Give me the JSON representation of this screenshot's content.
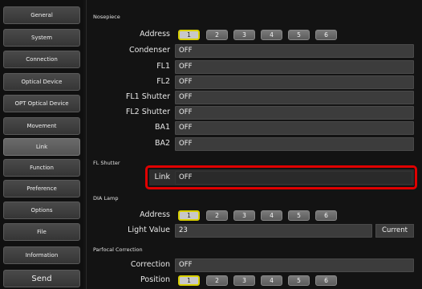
{
  "sidebar": {
    "items": [
      "General",
      "System",
      "Connection",
      "Optical Device",
      "OPT Optical Device",
      "Movement",
      "Link",
      "Function",
      "Preference",
      "Options",
      "File",
      "Information"
    ],
    "active": "Link",
    "send_label": "Send"
  },
  "nosepiece": {
    "title": "Nosepiece",
    "address_label": "Address",
    "addresses": [
      "1",
      "2",
      "3",
      "4",
      "5",
      "6"
    ],
    "selected": "1",
    "rows": [
      {
        "label": "Condenser",
        "value": "OFF"
      },
      {
        "label": "FL1",
        "value": "OFF"
      },
      {
        "label": "FL2",
        "value": "OFF"
      },
      {
        "label": "FL1 Shutter",
        "value": "OFF"
      },
      {
        "label": "FL2 Shutter",
        "value": "OFF"
      },
      {
        "label": "BA1",
        "value": "OFF"
      },
      {
        "label": "BA2",
        "value": "OFF"
      }
    ]
  },
  "fl_shutter": {
    "title": "FL Shutter",
    "link_label": "Link",
    "link_value": "OFF"
  },
  "dia_lamp": {
    "title": "DIA Lamp",
    "address_label": "Address",
    "addresses": [
      "1",
      "2",
      "3",
      "4",
      "5",
      "6"
    ],
    "selected": "1",
    "light_label": "Light Value",
    "light_value": "23",
    "current_label": "Current"
  },
  "parfocal": {
    "title": "Parfocal Correction",
    "correction_label": "Correction",
    "correction_value": "OFF",
    "position_label": "Position",
    "positions": [
      "1",
      "2",
      "3",
      "4",
      "5",
      "6"
    ],
    "selected": "1"
  },
  "colors": {
    "background": "#131313",
    "field": "#3c3c3c",
    "selected_border": "#d8d000",
    "highlight": "#e00000"
  }
}
